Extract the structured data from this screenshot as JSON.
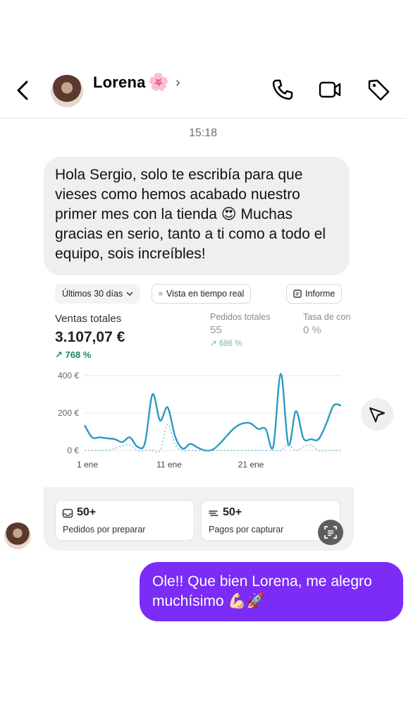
{
  "header": {
    "contact_name": "Lorena",
    "contact_emoji": "🌸",
    "chevron": "›",
    "icons": [
      "back-icon",
      "phone-icon",
      "video-icon",
      "tag-icon"
    ]
  },
  "timestamp": "15:18",
  "incoming_message": "Hola Sergio, solo te escribía para que vieses como hemos acabado nuestro primer mes con la tienda 😍 Muchas gracias en serio, tanto a ti como a todo el equipo, sois increíbles!",
  "outgoing_message": "Ole!! Que bien Lorena, me alegro muchísimo 💪🏻🚀",
  "colors": {
    "outgoing_bubble": "#7b2cf5",
    "incoming_bubble": "#efefef",
    "chart_line": "#2a9bc1",
    "delta_green": "#1a8a5a"
  },
  "dashboard": {
    "filter_period": "Últimos 30 días",
    "filter_realtime": "Vista en tiempo real",
    "report_button": "Informe",
    "metrics": {
      "sales_label": "Ventas totales",
      "sales_value": "3.107,07 €",
      "sales_delta": "↗ 768 %",
      "orders_label": "Pedidos totales",
      "orders_value": "55",
      "orders_delta": "↗ 686 %",
      "rate_label": "Tasa de con",
      "rate_value": "0 %"
    },
    "cards": [
      {
        "value": "50+",
        "label": "Pedidos por preparar",
        "icon": "inbox-icon"
      },
      {
        "value": "50+",
        "label": "Pagos por capturar",
        "icon": "cash-icon"
      }
    ]
  },
  "chart_data": {
    "type": "line",
    "x_tick_labels": [
      "1 ene",
      "11 ene",
      "21 ene"
    ],
    "y_tick_labels": [
      "400 €",
      "200 €",
      "0 €"
    ],
    "ylim": [
      0,
      400
    ],
    "grid": true,
    "series": [
      {
        "style": "solid",
        "values": [
          135,
          70,
          70,
          65,
          60,
          45,
          70,
          20,
          40,
          300,
          160,
          230,
          75,
          10,
          35,
          15,
          0,
          5,
          40,
          85,
          125,
          145,
          145,
          115,
          115,
          20,
          410,
          30,
          210,
          65,
          60,
          60,
          140,
          240,
          240
        ]
      },
      {
        "style": "dotted",
        "values": [
          0,
          0,
          0,
          0,
          10,
          25,
          30,
          0,
          0,
          0,
          0,
          140,
          30,
          0,
          0,
          0,
          0,
          0,
          0,
          0,
          0,
          0,
          0,
          0,
          0,
          0,
          0,
          30,
          0,
          20,
          30,
          0,
          0,
          0,
          0
        ]
      }
    ]
  }
}
